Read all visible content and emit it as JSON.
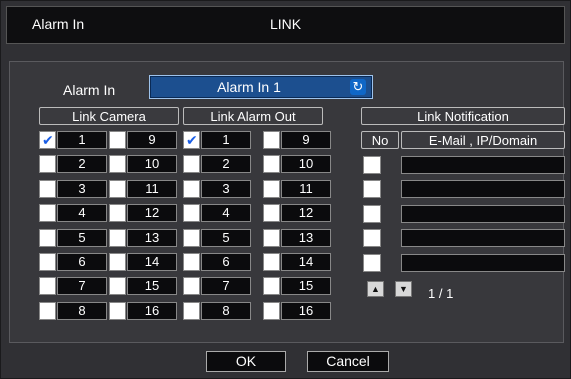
{
  "window": {
    "title_left": "Alarm In",
    "title_center": "LINK"
  },
  "alarm_in": {
    "label": "Alarm In",
    "value": "Alarm In 1",
    "refresh_icon": "refresh-icon"
  },
  "link_camera": {
    "header": "Link Camera",
    "items": [
      {
        "label": "1",
        "checked": true
      },
      {
        "label": "2",
        "checked": false
      },
      {
        "label": "3",
        "checked": false
      },
      {
        "label": "4",
        "checked": false
      },
      {
        "label": "5",
        "checked": false
      },
      {
        "label": "6",
        "checked": false
      },
      {
        "label": "7",
        "checked": false
      },
      {
        "label": "8",
        "checked": false
      },
      {
        "label": "9",
        "checked": false
      },
      {
        "label": "10",
        "checked": false
      },
      {
        "label": "11",
        "checked": false
      },
      {
        "label": "12",
        "checked": false
      },
      {
        "label": "13",
        "checked": false
      },
      {
        "label": "14",
        "checked": false
      },
      {
        "label": "15",
        "checked": false
      },
      {
        "label": "16",
        "checked": false
      }
    ]
  },
  "link_alarm_out": {
    "header": "Link Alarm Out",
    "items": [
      {
        "label": "1",
        "checked": true
      },
      {
        "label": "2",
        "checked": false
      },
      {
        "label": "3",
        "checked": false
      },
      {
        "label": "4",
        "checked": false
      },
      {
        "label": "5",
        "checked": false
      },
      {
        "label": "6",
        "checked": false
      },
      {
        "label": "7",
        "checked": false
      },
      {
        "label": "8",
        "checked": false
      },
      {
        "label": "9",
        "checked": false
      },
      {
        "label": "10",
        "checked": false
      },
      {
        "label": "11",
        "checked": false
      },
      {
        "label": "12",
        "checked": false
      },
      {
        "label": "13",
        "checked": false
      },
      {
        "label": "14",
        "checked": false
      },
      {
        "label": "15",
        "checked": false
      },
      {
        "label": "16",
        "checked": false
      }
    ]
  },
  "link_notification": {
    "header": "Link Notification",
    "col_no": "No",
    "col_target": "E-Mail , IP/Domain",
    "rows": [
      {
        "checked": false,
        "value": ""
      },
      {
        "checked": false,
        "value": ""
      },
      {
        "checked": false,
        "value": ""
      },
      {
        "checked": false,
        "value": ""
      },
      {
        "checked": false,
        "value": ""
      }
    ],
    "pager": "1 / 1"
  },
  "buttons": {
    "ok": "OK",
    "cancel": "Cancel"
  }
}
